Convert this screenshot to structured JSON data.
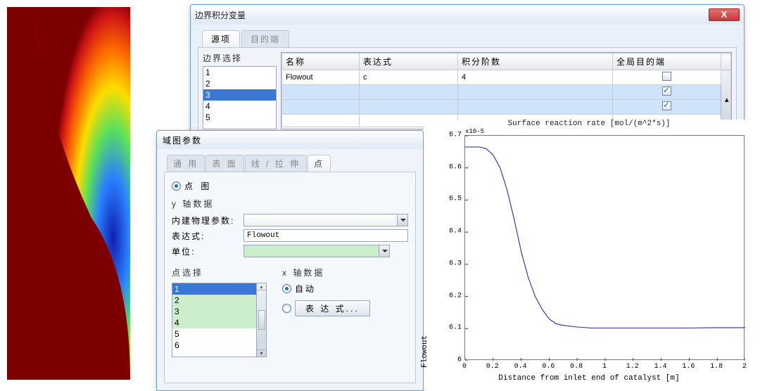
{
  "dialog1": {
    "title": "边界积分变量",
    "tabs": [
      "源项",
      "目的端"
    ],
    "boundary_select_label": "边界选择",
    "boundary_list": [
      "1",
      "2",
      "3",
      "4",
      "5"
    ],
    "boundary_selected_index": 2,
    "columns": [
      "名称",
      "表达式",
      "积分阶数",
      "全局目的端"
    ],
    "rows": [
      {
        "name": "Flowout",
        "expr": "c",
        "order": "4",
        "dest": false
      },
      {
        "name": "",
        "expr": "",
        "order": "",
        "dest": true
      },
      {
        "name": "",
        "expr": "",
        "order": "",
        "dest": true
      }
    ]
  },
  "dialog2": {
    "title": "域图参数",
    "tabs": [
      "通 用",
      "表 面",
      "线 / 拉 伸",
      "点"
    ],
    "active_tab_index": 3,
    "radio_label": "点 图",
    "y_section": "y 轴数据",
    "builtin_label": "内建物理参数:",
    "expr_label": "表达式:",
    "expr_value": "Flowout",
    "unit_label": "单位:",
    "point_select_label": "点选择",
    "point_list": [
      "1",
      "2",
      "3",
      "4",
      "5",
      "6"
    ],
    "point_selected_index": 0,
    "x_section": "x 轴数据",
    "x_radio_auto": "自动",
    "x_btn_expr": "表 达 式..."
  },
  "chart_data": {
    "type": "line",
    "title": "Surface reaction rate [mol/(m^2*s)]",
    "xlabel": "Distance from inlet end of catalyst [m]",
    "ylabel": "Flowout",
    "y_exponent": "x10^-5",
    "y_exponent_raw": "x10-5",
    "xlim": [
      0,
      2
    ],
    "ylim": [
      6,
      6.7
    ],
    "xticks": [
      0,
      0.2,
      0.4,
      0.6,
      0.8,
      1,
      1.2,
      1.4,
      1.6,
      1.8,
      2
    ],
    "yticks": [
      6,
      6.1,
      6.2,
      6.3,
      6.4,
      6.5,
      6.6,
      6.7
    ],
    "series": [
      {
        "name": "Flowout",
        "x": [
          0.0,
          0.05,
          0.1,
          0.15,
          0.2,
          0.25,
          0.3,
          0.35,
          0.4,
          0.45,
          0.5,
          0.55,
          0.6,
          0.65,
          0.7,
          0.8,
          0.9,
          1.0,
          1.2,
          1.4,
          1.6,
          1.8,
          2.0
        ],
        "values": [
          6.665,
          6.665,
          6.665,
          6.66,
          6.64,
          6.6,
          6.53,
          6.44,
          6.34,
          6.26,
          6.2,
          6.16,
          6.13,
          6.115,
          6.11,
          6.105,
          6.102,
          6.102,
          6.102,
          6.102,
          6.102,
          6.103,
          6.103
        ]
      }
    ]
  }
}
